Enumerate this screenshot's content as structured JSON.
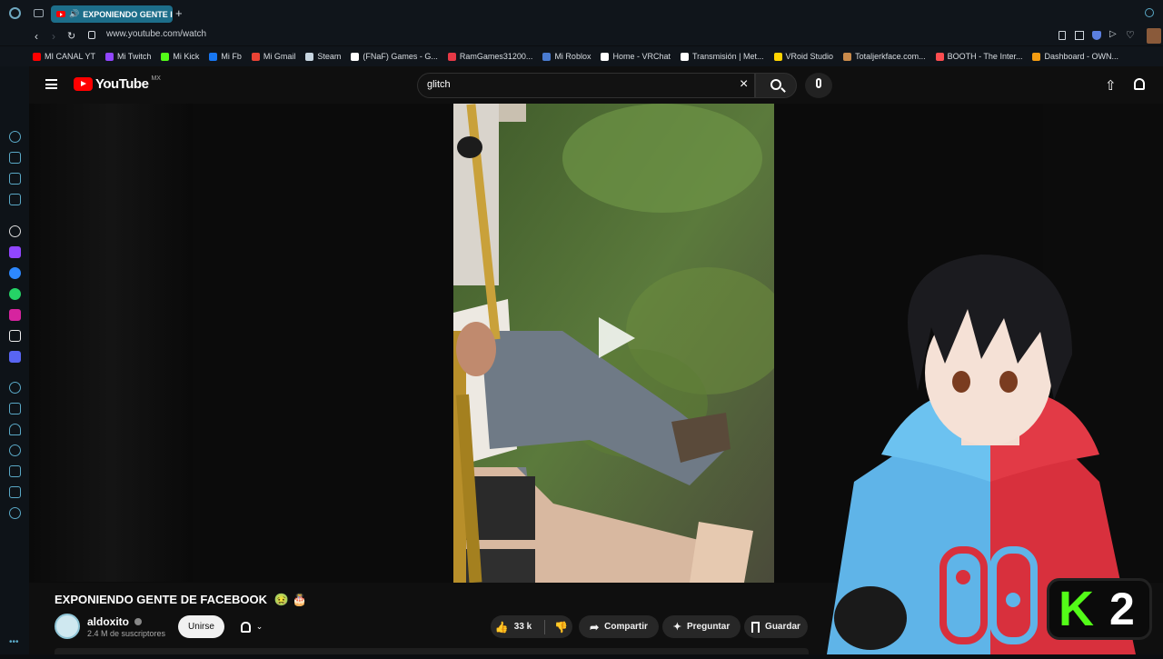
{
  "browser": {
    "tab_title": "EXPONIENDO GENTE I",
    "url": "www.youtube.com/watch",
    "bookmarks": [
      {
        "label": "MI CANAL YT",
        "color": "#ff0000"
      },
      {
        "label": "Mi Twitch",
        "color": "#9146ff"
      },
      {
        "label": "Mi Kick",
        "color": "#53fc18"
      },
      {
        "label": "Mi Fb",
        "color": "#1877f2"
      },
      {
        "label": "Mi Gmail",
        "color": "#ea4335"
      },
      {
        "label": "Steam",
        "color": "#c7d5e0"
      },
      {
        "label": "(FNaF) Games - G...",
        "color": "#ffffff"
      },
      {
        "label": "RamGames31200...",
        "color": "#e63946"
      },
      {
        "label": "Mi Roblox",
        "color": "#4a7bd0"
      },
      {
        "label": "Home - VRChat",
        "color": "#ffffff"
      },
      {
        "label": "Transmisión | Met...",
        "color": "#ffffff"
      },
      {
        "label": "VRoid Studio",
        "color": "#ffd400"
      },
      {
        "label": "Totaljerkface.com...",
        "color": "#c98a4b"
      },
      {
        "label": "BOOTH - The Inter...",
        "color": "#fc4d50"
      },
      {
        "label": "Dashboard - OWN...",
        "color": "#f39c12"
      }
    ]
  },
  "youtube": {
    "logo_text": "YouTube",
    "region": "MX",
    "search_value": "glitch",
    "icons": {
      "menu": "menu-icon",
      "clear": "close-icon",
      "search": "search-icon",
      "mic": "mic-icon",
      "upload": "upload-icon",
      "notifications": "bell-icon"
    }
  },
  "video": {
    "title": "EXPONIENDO GENTE DE FACEBOOK",
    "emojis": "🤢 🎂",
    "channel": "aldoxito",
    "subscribers": "2.4 M de suscriptores",
    "join_label": "Unirse",
    "likes": "33 k",
    "share_label": "Compartir",
    "ask_label": "Preguntar",
    "save_label": "Guardar"
  },
  "overlay": {
    "badge_text": "2",
    "badge_letter": "K"
  }
}
